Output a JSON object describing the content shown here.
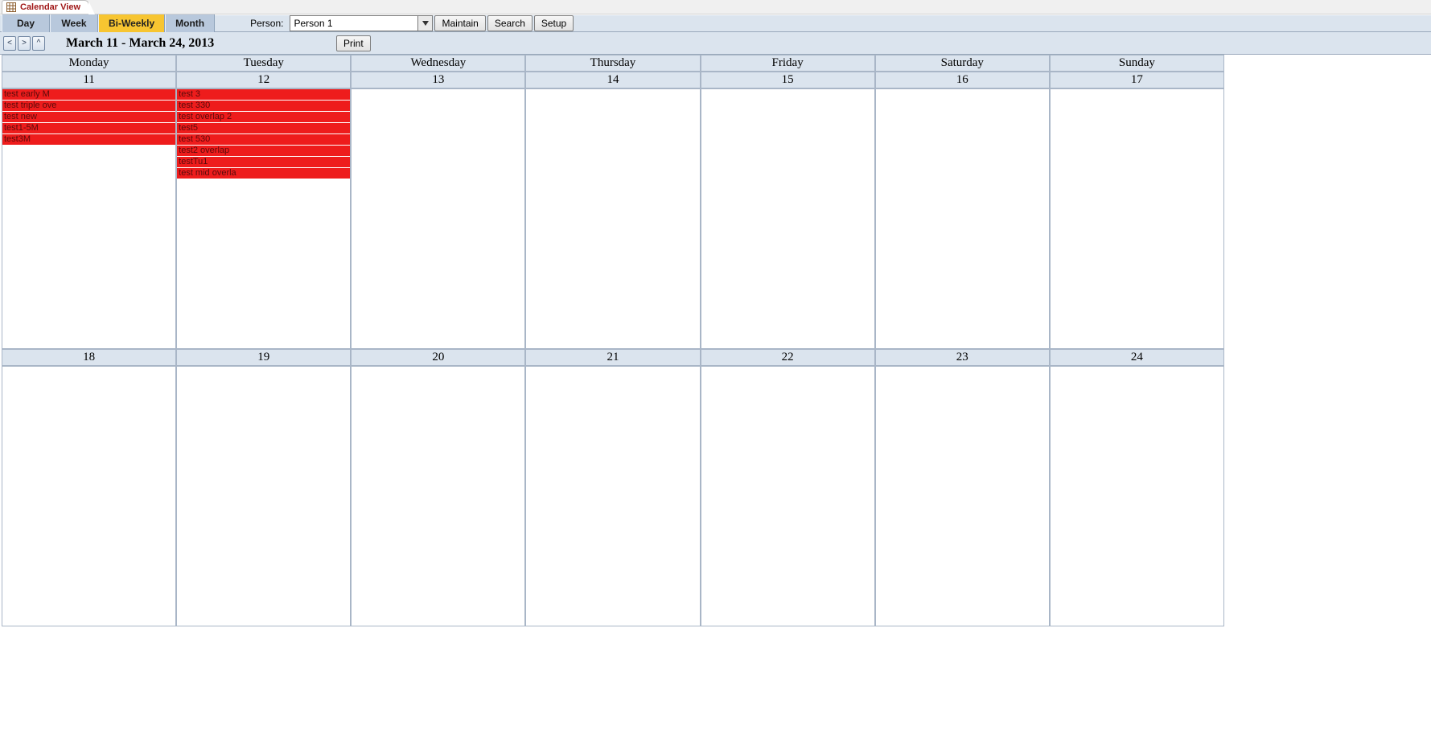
{
  "tab": {
    "title": "Calendar View"
  },
  "views": {
    "items": [
      "Day",
      "Week",
      "Bi-Weekly",
      "Month"
    ],
    "active_index": 2
  },
  "person": {
    "label": "Person:",
    "value": "Person 1"
  },
  "buttons": {
    "maintain": "Maintain",
    "search": "Search",
    "setup": "Setup",
    "print": "Print"
  },
  "nav": {
    "prev": "<",
    "next": ">",
    "up": "^"
  },
  "date_range": "March 11 - March 24, 2013",
  "weekdays": [
    "Monday",
    "Tuesday",
    "Wednesday",
    "Thursday",
    "Friday",
    "Saturday",
    "Sunday"
  ],
  "weeks": [
    {
      "dates": [
        "11",
        "12",
        "13",
        "14",
        "15",
        "16",
        "17"
      ],
      "events": [
        [
          "test early M",
          "test triple ove",
          "test new",
          "test1-5M",
          "test3M"
        ],
        [
          "test 3",
          "test 330",
          "test overlap 2",
          "test5",
          "test 530",
          "test2 overlap",
          "testTu1",
          "test mid overla"
        ],
        [],
        [],
        [],
        [],
        []
      ]
    },
    {
      "dates": [
        "18",
        "19",
        "20",
        "21",
        "22",
        "23",
        "24"
      ],
      "events": [
        [],
        [],
        [],
        [],
        [],
        [],
        []
      ]
    }
  ]
}
